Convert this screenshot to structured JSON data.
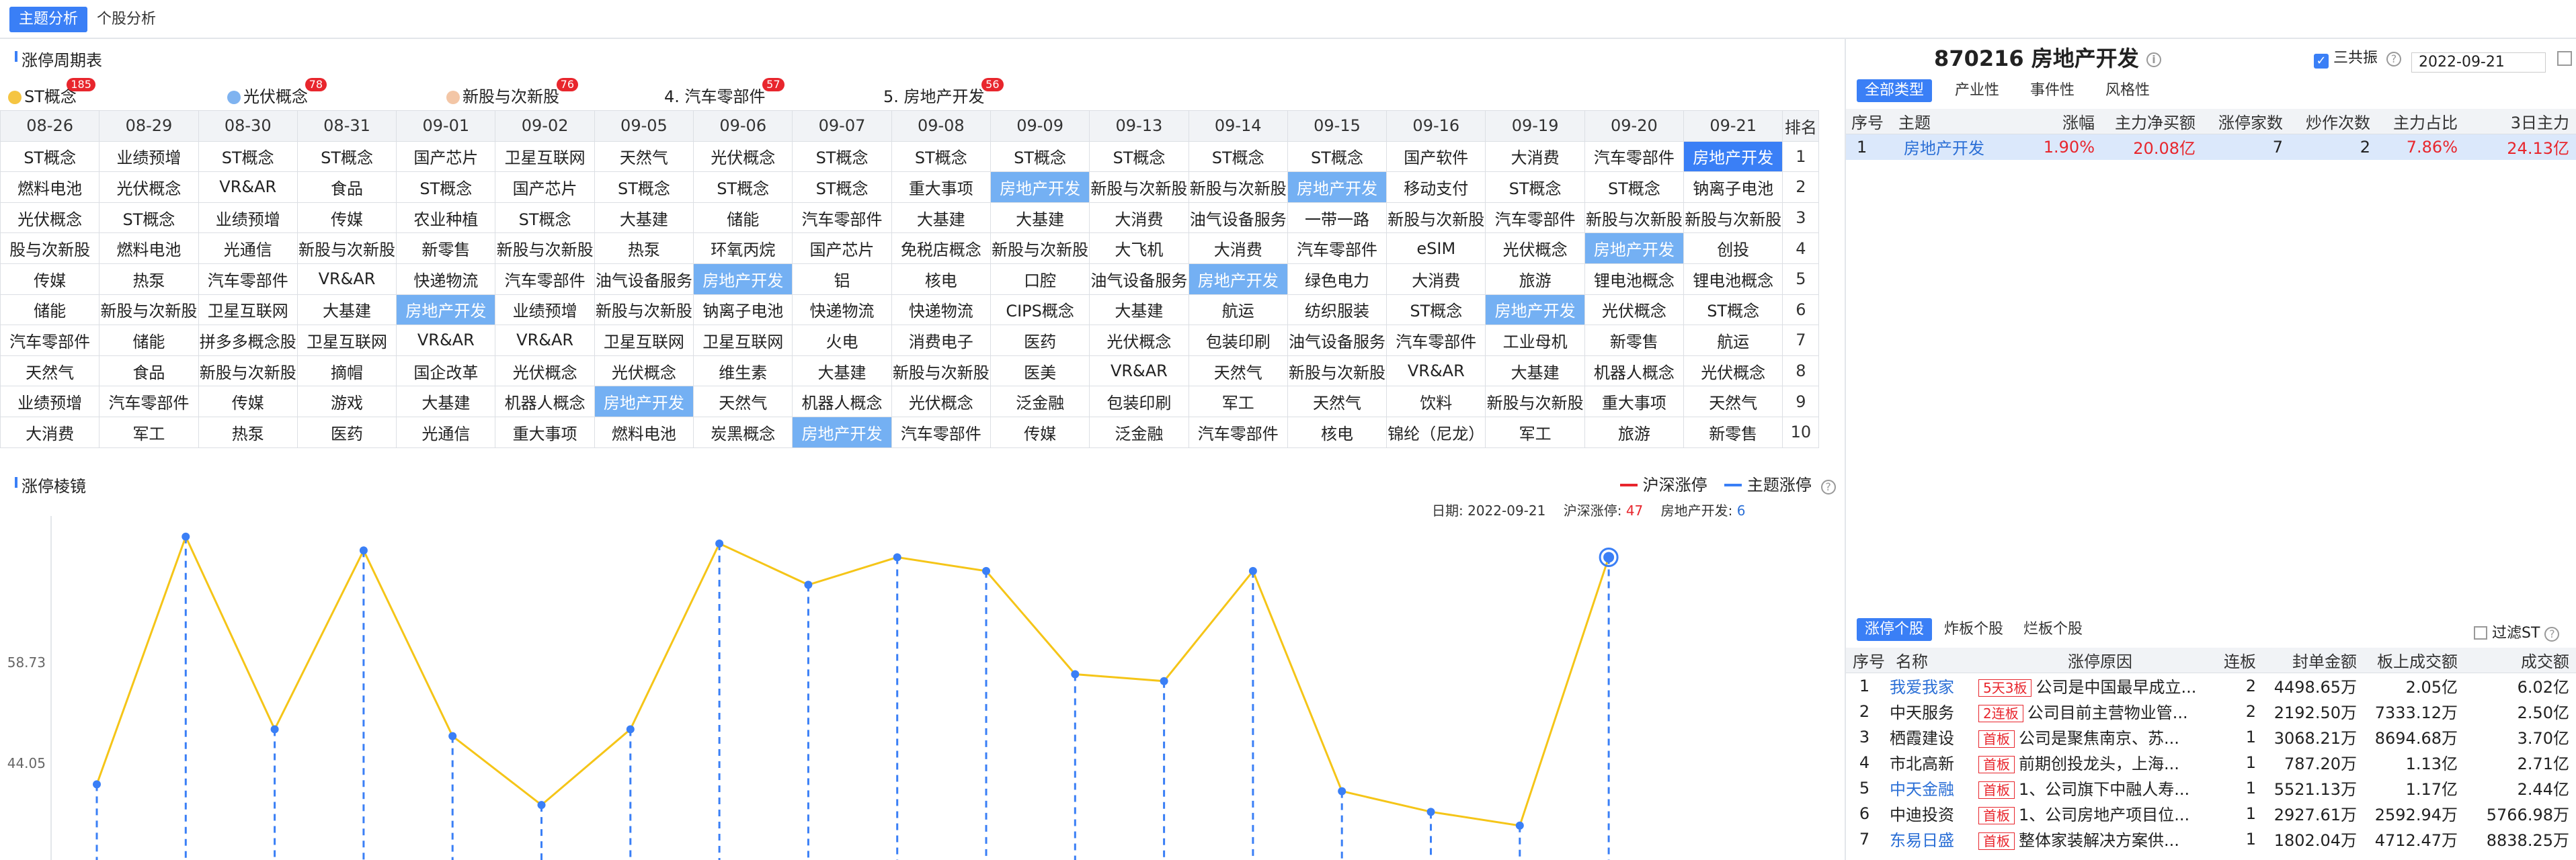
{
  "top_tabs": [
    "主题分析",
    "个股分析"
  ],
  "cycle": {
    "title": "涨停周期表",
    "concepts": [
      {
        "label": "ST概念",
        "count": "185",
        "dot": "#f5c542"
      },
      {
        "label": "光伏概念",
        "count": "78",
        "dot": "#7fb3f0"
      },
      {
        "label": "新股与次新股",
        "count": "76",
        "dot": "#f3c6a6"
      },
      {
        "label": "4. 汽车零部件",
        "count": "57",
        "dot": ""
      },
      {
        "label": "5. 房地产开发",
        "count": "56",
        "dot": ""
      }
    ],
    "headers": [
      "08-26",
      "08-29",
      "08-30",
      "08-31",
      "09-01",
      "09-02",
      "09-05",
      "09-06",
      "09-07",
      "09-08",
      "09-09",
      "09-13",
      "09-14",
      "09-15",
      "09-16",
      "09-19",
      "09-20",
      "09-21",
      "排名"
    ],
    "rows": [
      [
        "ST概念",
        "业绩预增",
        "ST概念",
        "ST概念",
        "国产芯片",
        "卫星互联网",
        "天然气",
        "光伏概念",
        "ST概念",
        "ST概念",
        "ST概念",
        "ST概念",
        "ST概念",
        "ST概念",
        "国产软件",
        "大消费",
        "汽车零部件",
        "房地产开发",
        "1"
      ],
      [
        "燃料电池",
        "光伏概念",
        "VR&AR",
        "食品",
        "ST概念",
        "国产芯片",
        "ST概念",
        "ST概念",
        "ST概念",
        "重大事项",
        "房地产开发",
        "新股与次新股",
        "新股与次新股",
        "房地产开发",
        "移动支付",
        "ST概念",
        "ST概念",
        "钠离子电池",
        "2"
      ],
      [
        "光伏概念",
        "ST概念",
        "业绩预增",
        "传媒",
        "农业种植",
        "ST概念",
        "大基建",
        "储能",
        "汽车零部件",
        "大基建",
        "大基建",
        "大消费",
        "油气设备服务",
        "一带一路",
        "新股与次新股",
        "汽车零部件",
        "新股与次新股",
        "新股与次新股",
        "3"
      ],
      [
        "股与次新股",
        "燃料电池",
        "光通信",
        "新股与次新股",
        "新零售",
        "新股与次新股",
        "热泵",
        "环氧丙烷",
        "国产芯片",
        "免税店概念",
        "新股与次新股",
        "大飞机",
        "大消费",
        "汽车零部件",
        "eSIM",
        "光伏概念",
        "房地产开发",
        "创投",
        "4"
      ],
      [
        "传媒",
        "热泵",
        "汽车零部件",
        "VR&AR",
        "快递物流",
        "汽车零部件",
        "油气设备服务",
        "房地产开发",
        "铝",
        "核电",
        "口腔",
        "油气设备服务",
        "房地产开发",
        "绿色电力",
        "大消费",
        "旅游",
        "锂电池概念",
        "锂电池概念",
        "5"
      ],
      [
        "储能",
        "新股与次新股",
        "卫星互联网",
        "大基建",
        "房地产开发",
        "业绩预增",
        "新股与次新股",
        "钠离子电池",
        "快递物流",
        "快递物流",
        "CIPS概念",
        "大基建",
        "航运",
        "纺织服装",
        "ST概念",
        "房地产开发",
        "光伏概念",
        "ST概念",
        "6"
      ],
      [
        "汽车零部件",
        "储能",
        "拼多多概念股",
        "卫星互联网",
        "VR&AR",
        "VR&AR",
        "卫星互联网",
        "卫星互联网",
        "火电",
        "消费电子",
        "医药",
        "光伏概念",
        "包装印刷",
        "油气设备服务",
        "汽车零部件",
        "工业母机",
        "新零售",
        "航运",
        "7"
      ],
      [
        "天然气",
        "食品",
        "新股与次新股",
        "摘帽",
        "国企改革",
        "光伏概念",
        "光伏概念",
        "维生素",
        "大基建",
        "新股与次新股",
        "医美",
        "VR&AR",
        "天然气",
        "新股与次新股",
        "VR&AR",
        "大基建",
        "机器人概念",
        "光伏概念",
        "8"
      ],
      [
        "业绩预增",
        "汽车零部件",
        "传媒",
        "游戏",
        "大基建",
        "机器人概念",
        "房地产开发",
        "天然气",
        "机器人概念",
        "光伏概念",
        "泛金融",
        "包装印刷",
        "军工",
        "天然气",
        "饮料",
        "新股与次新股",
        "重大事项",
        "天然气",
        "9"
      ],
      [
        "大消费",
        "军工",
        "热泵",
        "医药",
        "光通信",
        "重大事项",
        "燃料电池",
        "炭黑概念",
        "房地产开发",
        "汽车零部件",
        "传媒",
        "泛金融",
        "汽车零部件",
        "核电",
        "锦纶（尼龙）",
        "军工",
        "旅游",
        "新零售",
        "10"
      ]
    ]
  },
  "mirror": {
    "title": "涨停棱镜",
    "legend": [
      "沪深涨停",
      "主题涨停"
    ],
    "readout": {
      "date_label": "日期:",
      "date": "2022-09-21",
      "hs_label": "沪深涨停:",
      "hs": "47",
      "theme_label": "房地产开发:",
      "theme": "6"
    },
    "colors": {
      "line": "#f5c518",
      "bar": "#3a7ff6",
      "red": "#e8262d"
    }
  },
  "chart_data": {
    "type": "line",
    "x": [
      "08-26",
      "08-29",
      "08-30",
      "08-31",
      "09-01",
      "09-02",
      "09-05",
      "09-06",
      "09-07",
      "09-08",
      "09-09",
      "09-13",
      "09-14",
      "09-15",
      "09-16",
      "09-19",
      "09-20",
      "09-21"
    ],
    "series": [
      {
        "name": "沪深涨停",
        "values": [
          41,
          77,
          49,
          75,
          48,
          38,
          49,
          76,
          70,
          74,
          72,
          57,
          56,
          72,
          40,
          37,
          35,
          74
        ]
      }
    ],
    "yticks": [
      44.05,
      58.73
    ],
    "ylim": [
      30,
      80
    ],
    "selected_value": 47,
    "selected_index": 17,
    "grid": false
  },
  "stock": {
    "title": "870216 房地产开发",
    "checkbox_label": "三共振",
    "date": "2022-09-21",
    "type_tabs": [
      "全部类型",
      "产业性",
      "事件性",
      "风格性"
    ],
    "theme_headers": [
      "序号",
      "主题",
      "涨幅",
      "主力净买额",
      "涨停家数",
      "炒作次数",
      "主力占比",
      "3日主力"
    ],
    "theme_rows": [
      [
        "1",
        "房地产开发",
        "1.90%",
        "20.08亿",
        "7",
        "2",
        "7.86%",
        "24.13亿"
      ]
    ],
    "board_tabs": [
      "涨停个股",
      "炸板个股",
      "烂板个股"
    ],
    "filter_label": "过滤ST",
    "board_headers": [
      "序号",
      "名称",
      "涨停原因",
      "连板",
      "封单金额",
      "板上成交额",
      "成交额"
    ],
    "board_rows": [
      [
        "1",
        "我爱我家",
        "5天3板",
        "公司是中国最早成立...",
        "2",
        "4498.65万",
        "2.05亿",
        "6.02亿"
      ],
      [
        "2",
        "中天服务",
        "2连板",
        "公司目前主营物业管...",
        "2",
        "2192.50万",
        "7333.12万",
        "2.50亿"
      ],
      [
        "3",
        "栖霞建设",
        "首板",
        "公司是聚焦南京、苏...",
        "1",
        "3068.21万",
        "8694.68万",
        "3.70亿"
      ],
      [
        "4",
        "市北高新",
        "首板",
        "前期创投龙头，上海...",
        "1",
        "787.20万",
        "1.13亿",
        "2.71亿"
      ],
      [
        "5",
        "中天金融",
        "首板",
        "1、公司旗下中融人寿...",
        "1",
        "5521.13万",
        "1.17亿",
        "2.44亿"
      ],
      [
        "6",
        "中迪投资",
        "首板",
        "1、公司房地产项目位...",
        "1",
        "2927.61万",
        "2592.94万",
        "5766.98万"
      ],
      [
        "7",
        "东易日盛",
        "首板",
        "整体家装解决方案供...",
        "1",
        "1802.04万",
        "4712.47万",
        "8838.25万"
      ]
    ]
  }
}
